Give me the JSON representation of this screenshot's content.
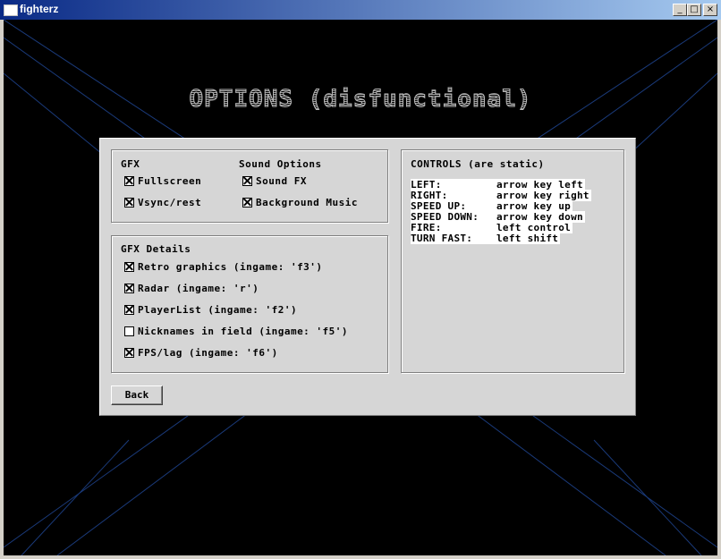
{
  "window": {
    "title": "fighterz",
    "controls": {
      "minimize": "_",
      "maximize": "□",
      "close": "×"
    }
  },
  "screen": {
    "heading": "OPTIONS (disfunctional)"
  },
  "gfx": {
    "label": "GFX",
    "items": [
      {
        "label": "Fullscreen",
        "checked": true
      },
      {
        "label": "Vsync/rest",
        "checked": true
      }
    ]
  },
  "sound": {
    "label": "Sound Options",
    "items": [
      {
        "label": "Sound FX",
        "checked": true
      },
      {
        "label": "Background Music",
        "checked": true
      }
    ]
  },
  "gfx_details": {
    "label": "GFX Details",
    "items": [
      {
        "label": "Retro graphics (ingame: 'f3')",
        "checked": true
      },
      {
        "label": "Radar (ingame: 'r')",
        "checked": true
      },
      {
        "label": "PlayerList (ingame: 'f2')",
        "checked": true
      },
      {
        "label": "Nicknames in field (ingame: 'f5')",
        "checked": false
      },
      {
        "label": "FPS/lag (ingame: 'f6')",
        "checked": true
      }
    ]
  },
  "controls": {
    "label": "CONTROLS (are static)",
    "rows": [
      {
        "key": "LEFT:",
        "action": "arrow key left"
      },
      {
        "key": "RIGHT:",
        "action": "arrow key right"
      },
      {
        "key": "SPEED UP:",
        "action": "arrow key up"
      },
      {
        "key": "SPEED DOWN:",
        "action": "arrow key down"
      },
      {
        "key": "FIRE:",
        "action": "left control"
      },
      {
        "key": "TURN FAST:",
        "action": "left shift"
      }
    ]
  },
  "back_label": "Back",
  "colors": {
    "background": "#000000",
    "grid_line": "#1a3a7a",
    "panel": "#d6d6d6"
  }
}
